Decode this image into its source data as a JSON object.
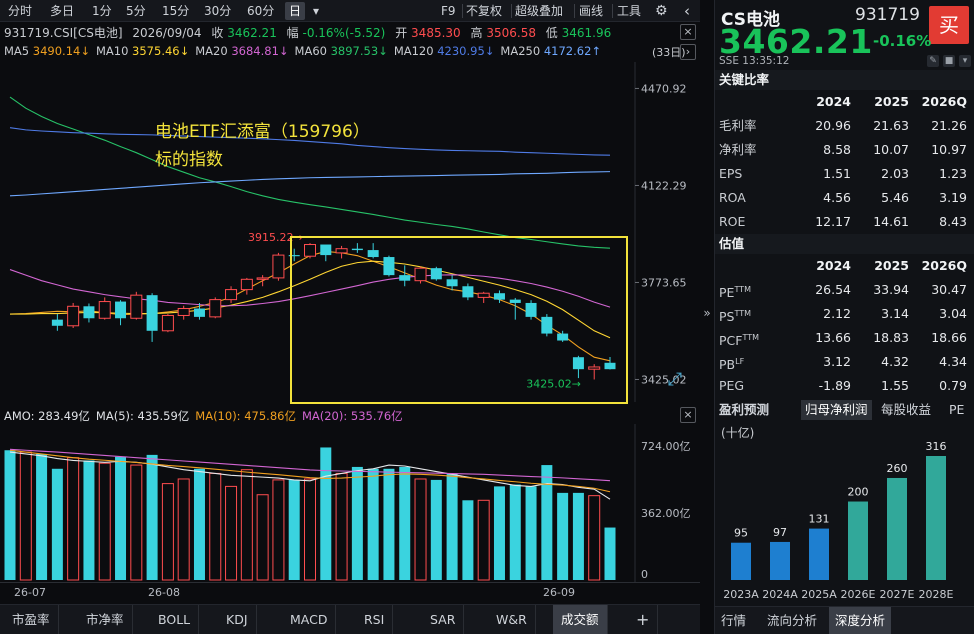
{
  "toolbar": {
    "periods": [
      "分时",
      "多日",
      "1分",
      "5分",
      "15分",
      "30分",
      "60分",
      "日"
    ],
    "active_period": "日",
    "dropdown_glyph": "▾",
    "tools": [
      "F9",
      "不复权",
      "超级叠加",
      "画线",
      "工具"
    ]
  },
  "info": {
    "code_name": "931719.CSI[CS电池]",
    "date": "2026/09/04",
    "close_label": "收",
    "close": "3462.21",
    "change_label": "幅",
    "change": "-0.16%(-5.52)",
    "open_label": "开",
    "open": "3485.30",
    "high_label": "高",
    "high": "3506.58",
    "low_label": "低",
    "low": "3461.96"
  },
  "ma_legend": [
    {
      "label": "MA5",
      "value": "3490.14↓",
      "color": "#f0a020"
    },
    {
      "label": "MA10",
      "value": "3575.46↓",
      "color": "#ffd633"
    },
    {
      "label": "MA20",
      "value": "3684.81↓",
      "color": "#d266d2"
    },
    {
      "label": "MA60",
      "value": "3897.53↓",
      "color": "#27c268"
    },
    {
      "label": "MA120",
      "value": "4230.95↓",
      "color": "#4f7be6"
    },
    {
      "label": "MA250",
      "value": "4172.62↑",
      "color": "#6fa8ff"
    }
  ],
  "period_count": "(33日)",
  "annotation": {
    "line1": "电池ETF汇添富（159796）",
    "line2": "标的指数"
  },
  "amo_legend": [
    {
      "label": "AMO: ",
      "value": "283.49亿",
      "color": "#dfe2e6"
    },
    {
      "label": "MA(5): ",
      "value": "435.59亿",
      "color": "#dfe2e6"
    },
    {
      "label": "MA(10): ",
      "value": "475.86亿",
      "color": "#f0a020"
    },
    {
      "label": "MA(20): ",
      "value": "535.76亿",
      "color": "#d266d2"
    }
  ],
  "bottom_tabs": [
    "市盈率",
    "市净率",
    "BOLL",
    "KDJ",
    "MACD",
    "RSI",
    "SAR",
    "W&R",
    "成交额"
  ],
  "bottom_tabs_active": "成交额",
  "add_glyph": "+",
  "nav_glyphs": {
    "left": "‹",
    "right": "›",
    "close": "×",
    "gear": "⚙",
    "expand": "⤢",
    "collapse": "»"
  },
  "chart_data": [
    {
      "type": "candlestick",
      "title": "",
      "price_axis": {
        "ticks": [
          "4470.92",
          "4122.29",
          "3773.65",
          "3425.02"
        ],
        "range": [
          3380,
          4530
        ]
      },
      "time_axis": {
        "ticks": [
          "26-07",
          "26-08",
          "26-09"
        ]
      },
      "markers": {
        "high": "3915.22",
        "low": "3425.02"
      },
      "up_color": "#ff4d4f",
      "down_color": "#3ad3df",
      "candles": [
        [
          3640,
          3660,
          3600,
          3618
        ],
        [
          3618,
          3700,
          3610,
          3688
        ],
        [
          3688,
          3698,
          3630,
          3645
        ],
        [
          3645,
          3720,
          3640,
          3705
        ],
        [
          3705,
          3710,
          3620,
          3645
        ],
        [
          3645,
          3740,
          3640,
          3728
        ],
        [
          3728,
          3735,
          3560,
          3600
        ],
        [
          3600,
          3660,
          3595,
          3655
        ],
        [
          3655,
          3690,
          3640,
          3680
        ],
        [
          3680,
          3700,
          3640,
          3650
        ],
        [
          3650,
          3720,
          3645,
          3712
        ],
        [
          3712,
          3760,
          3700,
          3748
        ],
        [
          3748,
          3790,
          3730,
          3785
        ],
        [
          3785,
          3800,
          3760,
          3790
        ],
        [
          3790,
          3880,
          3780,
          3872
        ],
        [
          3872,
          3895,
          3850,
          3868
        ],
        [
          3868,
          3915,
          3860,
          3910
        ],
        [
          3910,
          3900,
          3850,
          3872
        ],
        [
          3880,
          3905,
          3860,
          3895
        ],
        [
          3895,
          3915,
          3880,
          3890
        ],
        [
          3890,
          3915,
          3860,
          3865
        ],
        [
          3865,
          3870,
          3795,
          3800
        ],
        [
          3800,
          3835,
          3760,
          3780
        ],
        [
          3780,
          3830,
          3770,
          3825
        ],
        [
          3825,
          3830,
          3780,
          3785
        ],
        [
          3785,
          3800,
          3745,
          3760
        ],
        [
          3760,
          3770,
          3710,
          3720
        ],
        [
          3720,
          3740,
          3700,
          3735
        ],
        [
          3735,
          3745,
          3700,
          3712
        ],
        [
          3712,
          3718,
          3640,
          3700
        ],
        [
          3700,
          3710,
          3640,
          3650
        ],
        [
          3650,
          3660,
          3580,
          3590
        ],
        [
          3590,
          3600,
          3560,
          3565
        ],
        [
          3505,
          3510,
          3430,
          3462
        ],
        [
          3462,
          3480,
          3425,
          3470
        ],
        [
          3485,
          3506,
          3461,
          3462
        ]
      ],
      "ma_lines": {
        "MA5": [
          3660,
          3662,
          3666,
          3670,
          3668,
          3672,
          3665,
          3658,
          3660,
          3662,
          3668,
          3675,
          3688,
          3702,
          3720,
          3750,
          3780,
          3808,
          3840,
          3870,
          3885,
          3880,
          3870,
          3850,
          3830,
          3808,
          3786,
          3764,
          3748,
          3740,
          3728,
          3712,
          3690,
          3660,
          3620,
          3585,
          3542,
          3505,
          3492
        ],
        "MA10": [
          3660,
          3660,
          3662,
          3662,
          3664,
          3666,
          3665,
          3663,
          3662,
          3662,
          3664,
          3668,
          3674,
          3682,
          3692,
          3705,
          3720,
          3740,
          3762,
          3785,
          3810,
          3832,
          3845,
          3850,
          3846,
          3840,
          3830,
          3818,
          3805,
          3792,
          3778,
          3764,
          3748,
          3730,
          3706,
          3676,
          3638,
          3600,
          3575
        ],
        "MA20": [
          3820,
          3800,
          3780,
          3765,
          3750,
          3740,
          3730,
          3722,
          3715,
          3710,
          3702,
          3698,
          3694,
          3690,
          3690,
          3692,
          3698,
          3705,
          3715,
          3726,
          3738,
          3750,
          3762,
          3775,
          3785,
          3792,
          3797,
          3800,
          3801,
          3800,
          3796,
          3789,
          3780,
          3770,
          3757,
          3742,
          3724,
          3703,
          3685
        ],
        "MA60": [
          4440,
          4400,
          4370,
          4345,
          4325,
          4305,
          4285,
          4262,
          4240,
          4215,
          4190,
          4170,
          4150,
          4135,
          4118,
          4100,
          4085,
          4072,
          4062,
          4053,
          4045,
          4036,
          4027,
          4018,
          4008,
          3998,
          3990,
          3982,
          3975,
          3966,
          3955,
          3945,
          3935,
          3928,
          3920,
          3912,
          3905,
          3900,
          3897
        ],
        "MA120": [
          4330,
          4322,
          4318,
          4315,
          4312,
          4310,
          4308,
          4306,
          4305,
          4304,
          4302,
          4300,
          4298,
          4296,
          4294,
          4292,
          4290,
          4287,
          4284,
          4280,
          4276,
          4272,
          4266,
          4262,
          4258,
          4255,
          4252,
          4250,
          4248,
          4247,
          4246,
          4245,
          4242,
          4240,
          4238,
          4236,
          4234,
          4232,
          4231
        ],
        "MA250": [
          4085,
          4088,
          4092,
          4096,
          4100,
          4104,
          4108,
          4112,
          4116,
          4120,
          4124,
          4128,
          4132,
          4135,
          4138,
          4141,
          4144,
          4146,
          4148,
          4150,
          4151,
          4152,
          4153,
          4154,
          4155,
          4156,
          4157,
          4158,
          4159,
          4160,
          4161,
          4162,
          4164,
          4165,
          4166,
          4168,
          4170,
          4171,
          4172
        ]
      }
    },
    {
      "type": "bar",
      "title": "成交额",
      "value_axis": {
        "ticks": [
          "724.00亿",
          "362.00亿",
          "0"
        ],
        "range": [
          0,
          820
        ]
      },
      "values": [
        700,
        690,
        680,
        600,
        660,
        645,
        630,
        665,
        620,
        675,
        520,
        545,
        600,
        575,
        505,
        595,
        460,
        540,
        540,
        545,
        715,
        575,
        610,
        600,
        600,
        610,
        545,
        540,
        575,
        430,
        430,
        505,
        515,
        505,
        620,
        470,
        470,
        455,
        283
      ],
      "ma_lines": {
        "MA(5)": [
          690,
          680,
          670,
          655,
          645,
          640,
          635,
          640,
          635,
          625,
          610,
          595,
          585,
          575,
          565,
          560,
          555,
          550,
          540,
          535,
          560,
          575,
          590,
          600,
          620,
          615,
          600,
          585,
          570,
          555,
          540,
          525,
          510,
          505,
          520,
          515,
          500,
          490,
          436
        ],
        "MA(10)": [
          700,
          690,
          680,
          670,
          660,
          652,
          646,
          640,
          634,
          626,
          618,
          612,
          605,
          598,
          590,
          582,
          575,
          568,
          560,
          552,
          548,
          550,
          555,
          560,
          568,
          572,
          570,
          566,
          560,
          552,
          545,
          537,
          530,
          522,
          516,
          512,
          505,
          495,
          476
        ],
        "MA(20)": [
          705,
          700,
          695,
          690,
          684,
          678,
          672,
          666,
          660,
          654,
          648,
          642,
          636,
          630,
          624,
          618,
          612,
          606,
          600,
          594,
          590,
          588,
          586,
          584,
          582,
          580,
          578,
          576,
          574,
          572,
          570,
          566,
          562,
          558,
          555,
          551,
          546,
          541,
          536
        ]
      }
    },
    {
      "type": "bar",
      "title": "盈利预测",
      "categories": [
        "2023A",
        "2024A",
        "2025A",
        "2026E",
        "2027E",
        "2028E"
      ],
      "values": [
        95,
        97,
        131,
        200,
        260,
        316
      ],
      "colors": [
        "#1e7fd0",
        "#1e7fd0",
        "#1e7fd0",
        "#31a89a",
        "#31a89a",
        "#31a89a"
      ]
    }
  ],
  "quote": {
    "name": "CS电池",
    "code": "931719",
    "buy_label": "买",
    "price": "3462.21",
    "change_pct": "-0.16%",
    "exchange_time": "SSE  13:35:12"
  },
  "ratios": {
    "title": "关键比率",
    "years": [
      "2024",
      "2025",
      "2026Q"
    ],
    "rows": [
      {
        "name": "毛利率",
        "v": [
          "20.96",
          "21.63",
          "21.26"
        ]
      },
      {
        "name": "净利率",
        "v": [
          "8.58",
          "10.07",
          "10.97"
        ]
      },
      {
        "name": "EPS",
        "v": [
          "1.51",
          "2.03",
          "1.23"
        ]
      },
      {
        "name": "ROA",
        "v": [
          "4.56",
          "5.46",
          "3.19"
        ]
      },
      {
        "name": "ROE",
        "v": [
          "12.17",
          "14.61",
          "8.43"
        ]
      }
    ]
  },
  "valuation": {
    "title": "估值",
    "years": [
      "2024",
      "2025",
      "2026Q"
    ],
    "rows": [
      {
        "name": "PETTM",
        "v": [
          "26.54",
          "33.94",
          "30.47"
        ]
      },
      {
        "name": "PSTTM",
        "v": [
          "2.12",
          "3.14",
          "3.04"
        ]
      },
      {
        "name": "PCFTTM",
        "v": [
          "13.66",
          "18.83",
          "18.66"
        ]
      },
      {
        "name": "PBLF",
        "v": [
          "3.12",
          "4.32",
          "4.34"
        ]
      },
      {
        "name": "PEG",
        "v": [
          "-1.89",
          "1.55",
          "0.79"
        ]
      }
    ]
  },
  "earnings": {
    "tabs": [
      "盈利预测",
      "归母净利润",
      "每股收益",
      "PE"
    ],
    "active_tab": "归母净利润",
    "unit": "(十亿)"
  },
  "right_tabs": [
    "行情",
    "流向分析",
    "深度分析"
  ],
  "right_tabs_active": "深度分析"
}
